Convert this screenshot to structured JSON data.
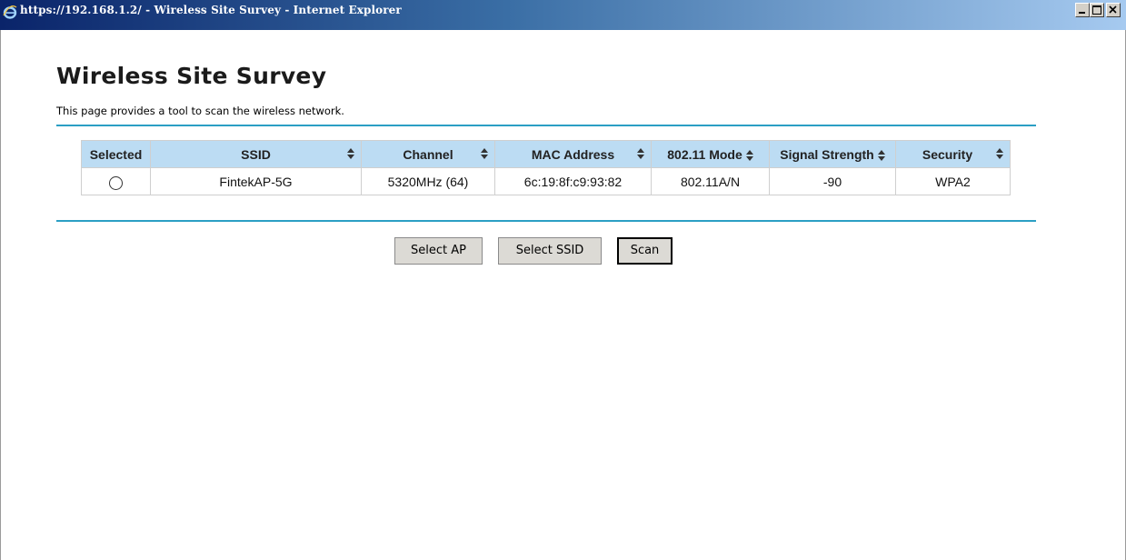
{
  "window": {
    "title": "https://192.168.1.2/ - Wireless Site Survey - Internet Explorer"
  },
  "page": {
    "title": "Wireless Site Survey",
    "description": "This page provides a tool to scan the wireless network."
  },
  "table": {
    "columns": [
      "Selected",
      "SSID",
      "Channel",
      "MAC Address",
      "802.11 Mode",
      "Signal Strength",
      "Security"
    ],
    "rows": [
      {
        "ssid": "FintekAP-5G",
        "channel": "5320MHz (64)",
        "mac": "6c:19:8f:c9:93:82",
        "mode": "802.11A/N",
        "signal": "-90",
        "security": "WPA2"
      }
    ]
  },
  "buttons": {
    "select_ap": "Select AP",
    "select_ssid": "Select SSID",
    "scan": "Scan"
  },
  "colors": {
    "header_bg": "#bcdcf3",
    "rule": "#2b9fc4"
  }
}
